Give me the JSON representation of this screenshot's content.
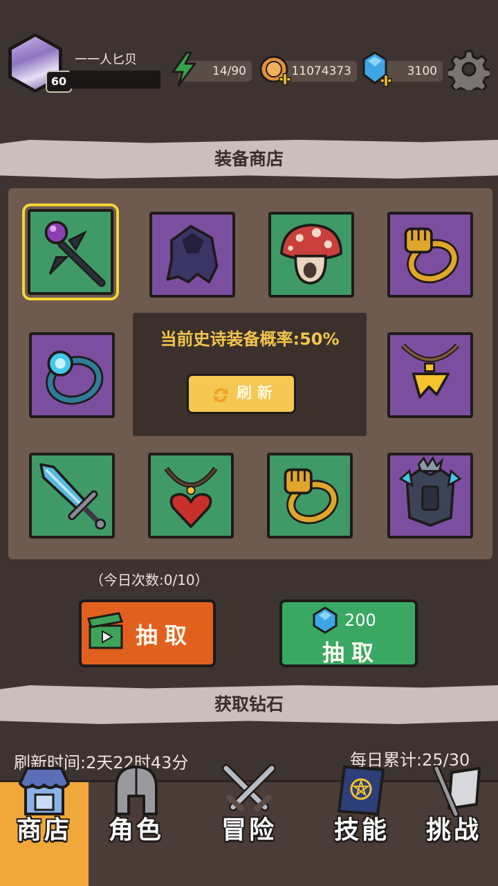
{
  "player": {
    "name": "一一人匕贝",
    "level": "60",
    "xp_fraction": 0.0
  },
  "resources": {
    "energy": "14/90",
    "gold": "11074373",
    "gems": "3100"
  },
  "shop": {
    "title": "装备商店",
    "epic_chance": "当前史诗装备概率:50%",
    "refresh_label": "刷 新",
    "items": [
      {
        "name": "orb-staff",
        "rarity": "green",
        "selected": true
      },
      {
        "name": "dark-cloak",
        "rarity": "purple"
      },
      {
        "name": "mushroom-hat",
        "rarity": "green"
      },
      {
        "name": "fist-ring",
        "rarity": "purple"
      },
      {
        "name": "ice-ring",
        "rarity": "purple"
      },
      {
        "name": "amulet",
        "rarity": "purple"
      },
      {
        "name": "crystal-sword",
        "rarity": "green"
      },
      {
        "name": "heart-necklace",
        "rarity": "green"
      },
      {
        "name": "fist-ring",
        "rarity": "green"
      },
      {
        "name": "spiked-armor",
        "rarity": "purple"
      }
    ],
    "daily_count": "（今日次数:0/10）",
    "draw_ad_label": "抽取",
    "draw_gem_cost": "200",
    "draw_gem_label": "抽取"
  },
  "diamonds": {
    "title": "获取钻石",
    "refresh_time": "刷新时间:2天22时43分",
    "daily_total": "每日累计:25/30"
  },
  "nav": {
    "tabs": [
      {
        "label": "商店",
        "icon": "shop-icon",
        "active": true
      },
      {
        "label": "角色",
        "icon": "helmet-icon",
        "active": false
      },
      {
        "label": "冒险",
        "icon": "crossed-swords-icon",
        "active": false
      },
      {
        "label": "技能",
        "icon": "spellbook-icon",
        "active": false
      },
      {
        "label": "挑战",
        "icon": "challenge-flag-icon",
        "active": false
      }
    ]
  },
  "colors": {
    "background": "#3d3330",
    "green_slot": "#3f9a68",
    "purple_slot": "#7c4ea0",
    "selected_outline": "#f5d535",
    "ad_button": "#e2601d",
    "gem_button": "#39a862",
    "active_tab": "#f1a83a"
  }
}
